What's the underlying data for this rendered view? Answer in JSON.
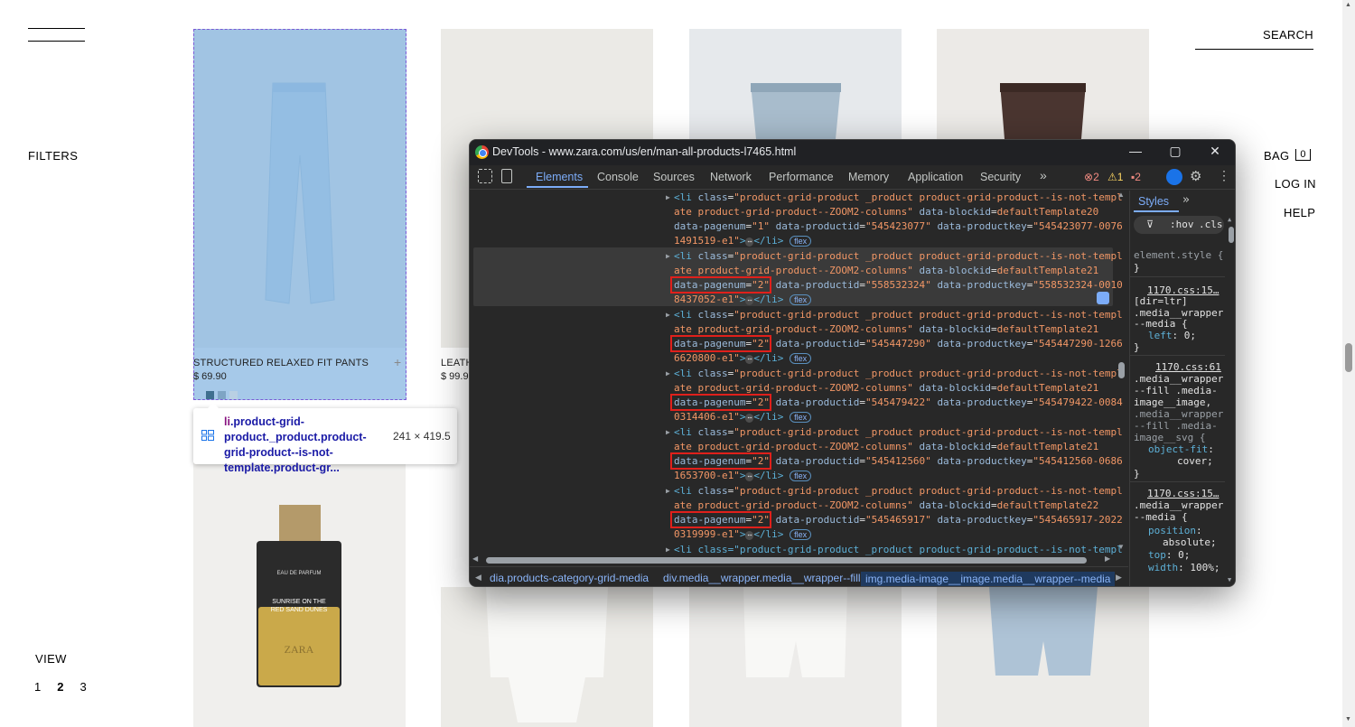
{
  "left_nav": {
    "filters": "FILTERS",
    "view": "VIEW",
    "pages": [
      "1",
      "2",
      "3"
    ],
    "current_page": "2"
  },
  "right_nav": {
    "search": "SEARCH",
    "bag": "BAG",
    "bag_count": "0",
    "login": "LOG IN",
    "help": "HELP"
  },
  "products": {
    "p1_name": "STRUCTURED RELAXED FIT PANTS",
    "p1_price": "$ 69.90",
    "p2_name": "LEATH",
    "p2_price": "$ 99.9",
    "perfume_brand": "EAU DE PARFUM",
    "perfume_name_1": "SUNRISE ON THE",
    "perfume_name_2": "RED SAND DUNES",
    "perfume_logo": "ZARA"
  },
  "tooltip": {
    "selector_tag": "li",
    "selector_rest": ".product-grid-product._product.product-grid-product--is-not-template.product-gr...",
    "dimensions": "241 × 419.5"
  },
  "devtools": {
    "title": "DevTools - www.zara.com/us/en/man-all-products-l7465.html",
    "tabs": [
      "Elements",
      "Console",
      "Sources",
      "Network",
      "Performance",
      "Memory",
      "Application",
      "Security"
    ],
    "more_tabs": "»",
    "errors": "2",
    "warnings": "1",
    "issues": "2",
    "rows": [
      {
        "blockid": "defaultTemplate20",
        "pagenum": "1",
        "productid": "545423077",
        "productkey_a": "545423077-0076",
        "productkey_b": "1491519-e1"
      },
      {
        "blockid": "defaultTemplate21",
        "pagenum": "2",
        "productid": "558532324",
        "productkey_a": "558532324-0010",
        "productkey_b": "8437052-e1"
      },
      {
        "blockid": "defaultTemplate21",
        "pagenum": "2",
        "productid": "545447290",
        "productkey_a": "545447290-1266",
        "productkey_b": "6620800-e1"
      },
      {
        "blockid": "defaultTemplate21",
        "pagenum": "2",
        "productid": "545479422",
        "productkey_a": "545479422-0084",
        "productkey_b": "0314406-e1"
      },
      {
        "blockid": "defaultTemplate21",
        "pagenum": "2",
        "productid": "545412560",
        "productkey_a": "545412560-0686",
        "productkey_b": "1653700-e1"
      },
      {
        "blockid": "defaultTemplate22",
        "pagenum": "2",
        "productid": "545465917",
        "productkey_a": "545465917-2022",
        "productkey_b": "0319999-e1"
      }
    ],
    "code": {
      "li_open": "<li ",
      "class_attr": "class",
      "class_val_1": "\"product-grid-product _product product-grid-product--is-not-templ",
      "class_val_2": "ate product-grid-product--ZOOM2-columns\"",
      "blockid_attr": "data-blockid",
      "pagenum_attr": "data-pagenum",
      "productid_attr": "data-productid",
      "productkey_attr": "data-productkey",
      "close": ">",
      "li_close": "</li>",
      "ellipsis": "⋯",
      "flex": "flex",
      "partial_line": "<li class=\"product-grid-product _product product-grid-product--is-not-templ"
    },
    "breadcrumbs": [
      "dia.products-category-grid-media",
      "div.media__wrapper.media__wrapper--fill",
      "img.media-image__image.media__wrapper--media"
    ],
    "styles": {
      "tab": "Styles",
      "more": "»",
      "filter_hov": ":hov",
      "filter_cls": ".cls",
      "element_style": "element.style {",
      "close_brace": "}",
      "rule1_src": "1170.css:15…",
      "rule1_sel_a": "[dir=ltr]",
      "rule1_sel_b": ".media__wrapper",
      "rule1_sel_c": "--media {",
      "rule1_prop": "left",
      "rule1_val": "0;",
      "rule2_src": "1170.css:61",
      "rule2_sel_a": ".media__wrapper",
      "rule2_sel_b": "--fill .media-",
      "rule2_sel_c": "image__image,",
      "rule2_sel_d": ".media__wrapper",
      "rule2_sel_e": "--fill .media-",
      "rule2_sel_f": "image__svg {",
      "rule2_prop": "object-fit",
      "rule2_val": "cover;",
      "rule3_src": "1170.css:15…",
      "rule3_sel_a": ".media__wrapper",
      "rule3_sel_b": "--media {",
      "rule3_prop1": "position",
      "rule3_val1": "absolute;",
      "rule3_prop2": "top",
      "rule3_val2": "0;",
      "rule3_prop3": "width",
      "rule3_val3": "100%;"
    }
  },
  "colors": {
    "highlight": "#6fa8dc",
    "devtools_bg": "#282828",
    "accent_blue": "#7cacf8",
    "red_box": "#e0201b",
    "attr_value": "#f29766"
  }
}
